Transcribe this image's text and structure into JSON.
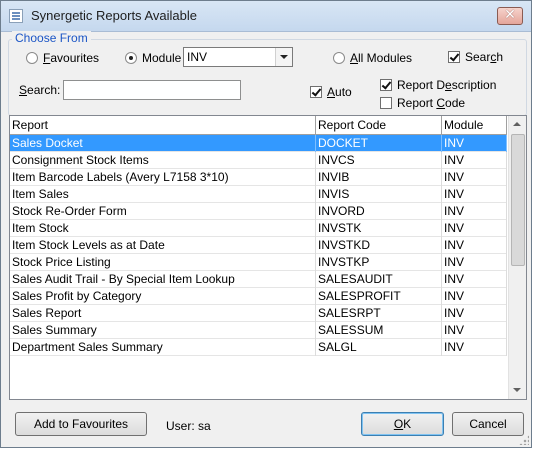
{
  "window": {
    "title": "Synergetic Reports Available",
    "close_glyph": "✕"
  },
  "choose_from": {
    "legend": "Choose From",
    "favourites": {
      "prefix": "",
      "underline": "F",
      "rest": "avourites",
      "selected": false
    },
    "module": {
      "label": "Module",
      "selected": true,
      "combo_value": "INV"
    },
    "all_modules": {
      "underline": "A",
      "rest": "ll Modules",
      "selected": false
    },
    "search_check": {
      "label_pre": "Sear",
      "underline": "c",
      "label_post": "h",
      "checked": true
    },
    "search_field": {
      "underline": "S",
      "rest": "earch:",
      "value": ""
    },
    "auto": {
      "underline": "A",
      "rest": "uto",
      "checked": true
    },
    "report_description": {
      "pre": "Report D",
      "underline": "e",
      "post": "scription",
      "checked": true
    },
    "report_code": {
      "pre": "Report ",
      "underline": "C",
      "post": "ode",
      "checked": false
    }
  },
  "grid": {
    "columns": [
      "Report",
      "Report Code",
      "Module"
    ],
    "selected_index": 0,
    "rows": [
      {
        "report": "Sales Docket",
        "code": "DOCKET",
        "module": "INV"
      },
      {
        "report": "Consignment Stock Items",
        "code": "INVCS",
        "module": "INV"
      },
      {
        "report": "Item Barcode Labels (Avery L7158 3*10)",
        "code": "INVIB",
        "module": "INV"
      },
      {
        "report": "Item Sales",
        "code": "INVIS",
        "module": "INV"
      },
      {
        "report": "Stock Re-Order Form",
        "code": "INVORD",
        "module": "INV"
      },
      {
        "report": "Item Stock",
        "code": "INVSTK",
        "module": "INV"
      },
      {
        "report": "Item Stock Levels as at Date",
        "code": "INVSTKD",
        "module": "INV"
      },
      {
        "report": "Stock Price Listing",
        "code": "INVSTKP",
        "module": "INV"
      },
      {
        "report": "Sales Audit Trail - By Special Item Lookup",
        "code": "SALESAUDIT",
        "module": "INV"
      },
      {
        "report": "Sales Profit by Category",
        "code": "SALESPROFIT",
        "module": "INV"
      },
      {
        "report": "Sales Report",
        "code": "SALESRPT",
        "module": "INV"
      },
      {
        "report": "Sales Summary",
        "code": "SALESSUM",
        "module": "INV"
      },
      {
        "report": "Department Sales Summary",
        "code": "SALGL",
        "module": "INV"
      }
    ]
  },
  "footer": {
    "add_to_favourites": "Add to Favourites",
    "user_text": "User: sa",
    "ok": {
      "underline": "O",
      "rest": "K"
    },
    "cancel": "Cancel"
  },
  "colors": {
    "selection": "#3399ff",
    "legend_text": "#1c56c6"
  }
}
